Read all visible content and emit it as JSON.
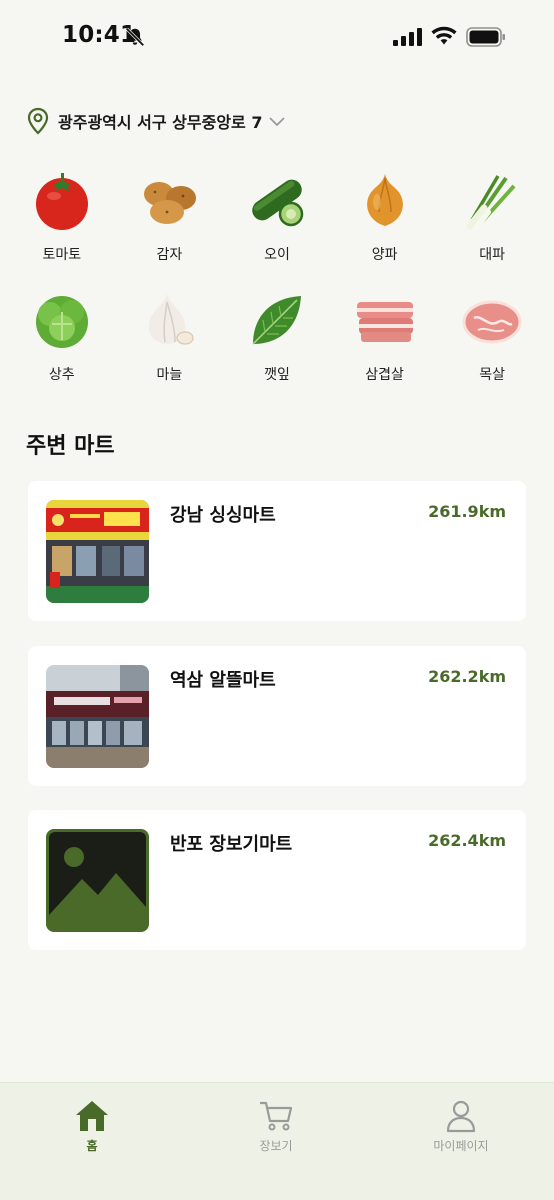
{
  "status": {
    "time": "10:41"
  },
  "location": {
    "address": "광주광역시 서구 상무중앙로 7"
  },
  "categories": [
    {
      "label": "토마토",
      "icon": "tomato-icon"
    },
    {
      "label": "감자",
      "icon": "potato-icon"
    },
    {
      "label": "오이",
      "icon": "cucumber-icon"
    },
    {
      "label": "양파",
      "icon": "onion-icon"
    },
    {
      "label": "대파",
      "icon": "green-onion-icon"
    },
    {
      "label": "상추",
      "icon": "lettuce-icon"
    },
    {
      "label": "마늘",
      "icon": "garlic-icon"
    },
    {
      "label": "깻잎",
      "icon": "perilla-leaf-icon"
    },
    {
      "label": "삼겹살",
      "icon": "pork-belly-icon"
    },
    {
      "label": "목살",
      "icon": "pork-neck-icon"
    }
  ],
  "nearby": {
    "title": "주변 마트",
    "stores": [
      {
        "name": "강남 싱싱마트",
        "distance": "261.9km"
      },
      {
        "name": "역삼 알뜰마트",
        "distance": "262.2km"
      },
      {
        "name": "반포 장보기마트",
        "distance": "262.4km"
      }
    ]
  },
  "tabs": [
    {
      "label": "홈",
      "icon": "home-icon",
      "active": true
    },
    {
      "label": "장보기",
      "icon": "cart-icon",
      "active": false
    },
    {
      "label": "마이페이지",
      "icon": "user-icon",
      "active": false
    }
  ],
  "colors": {
    "accent": "#4a6a2a",
    "background": "#f6f6f2",
    "tabbar": "#eef2e6",
    "inactive": "#9a9a9a"
  }
}
